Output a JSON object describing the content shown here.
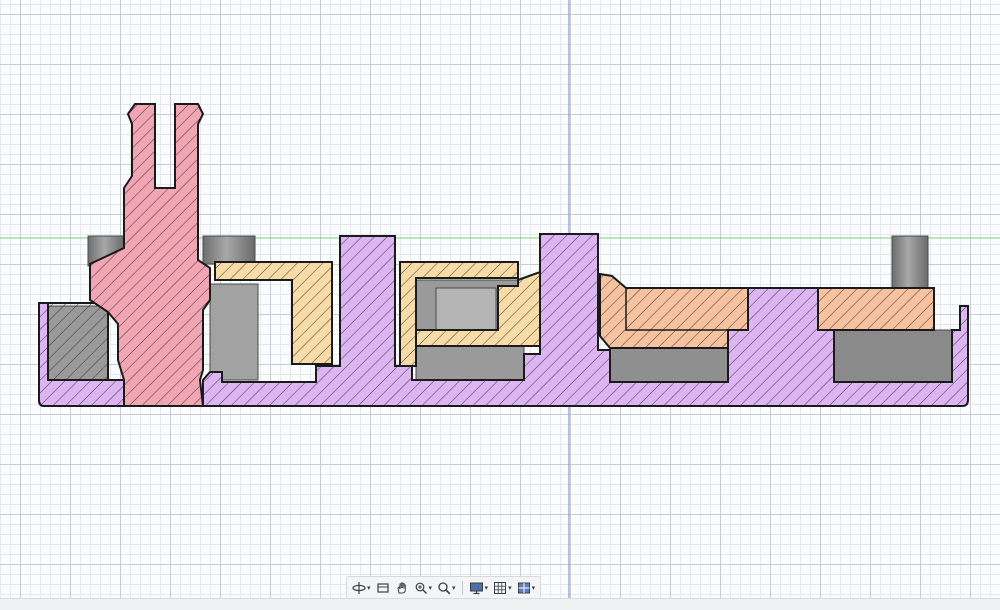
{
  "viewport": {
    "grid": "on",
    "axes": {
      "vertical_axis_color": "#7b7fd6",
      "horizontal_axis_color": "#7fd07f"
    }
  },
  "section_colors": {
    "base_plate": "#dcb5f2",
    "post": "#f2a6b4",
    "brackets": "#f8dca8",
    "pads": "#f6c2a0",
    "hidden_geometry": "#8d8d8d",
    "outline": "#1a1a1a"
  },
  "toolbar": {
    "buttons": [
      {
        "icon": "orbit-icon",
        "has_menu": true
      },
      {
        "icon": "look-at-icon",
        "has_menu": false
      },
      {
        "icon": "pan-hand-icon",
        "has_menu": false
      },
      {
        "icon": "zoom-window-icon",
        "has_menu": true
      },
      {
        "icon": "zoom-icon",
        "has_menu": true
      },
      {
        "icon": "display-settings-icon",
        "has_menu": true
      },
      {
        "icon": "grid-settings-icon",
        "has_menu": true
      },
      {
        "icon": "viewports-icon",
        "has_menu": true
      }
    ]
  }
}
